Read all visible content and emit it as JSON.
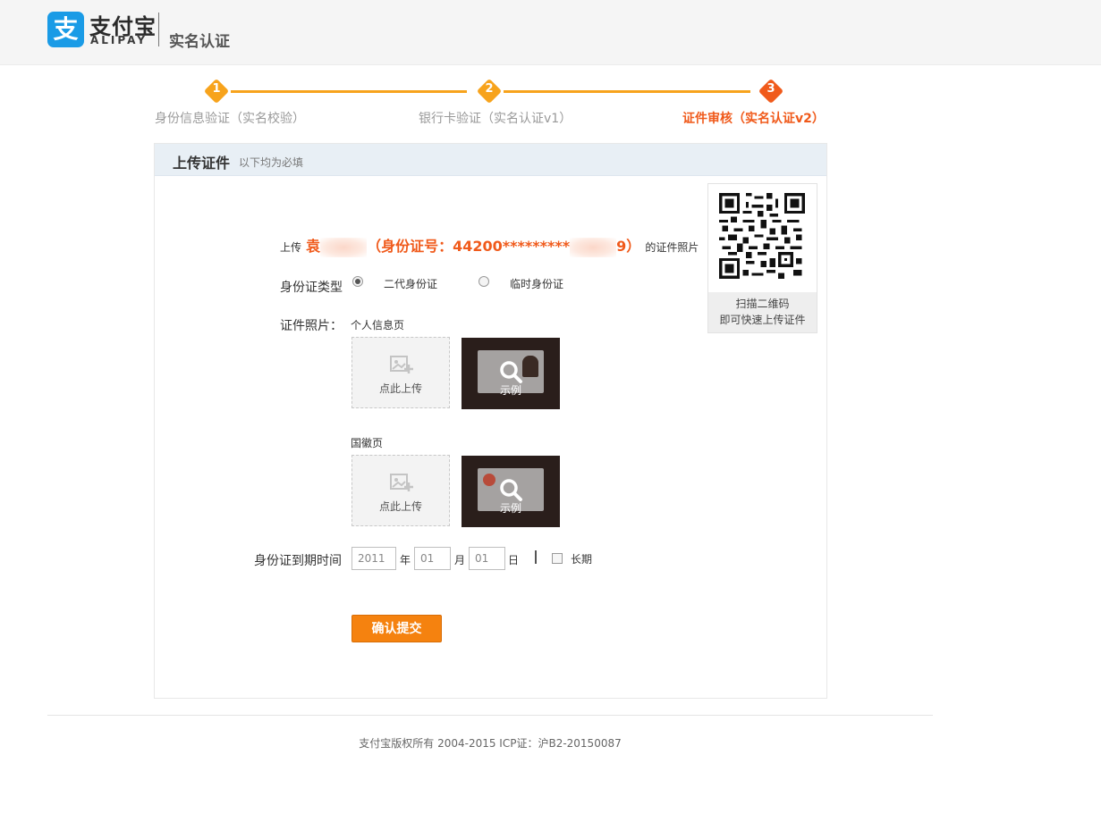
{
  "header": {
    "logo_glyph": "支",
    "logo_cn": "支付宝",
    "logo_en": "ALIPAY",
    "page_title": "实名认证"
  },
  "steps": [
    {
      "num": "1",
      "label": "身份信息验证（实名校验）",
      "active": false
    },
    {
      "num": "2",
      "label": "银行卡验证（实名认证v1）",
      "active": false
    },
    {
      "num": "3",
      "label": "证件审核（实名认证v2）",
      "active": true
    }
  ],
  "panel": {
    "title": "上传证件",
    "subtitle": "以下均为必填"
  },
  "upload_intro": {
    "prefix": "上传",
    "name_fragment": "袁",
    "id_label": "（身份证号：44200*********",
    "id_tail": "9）",
    "suffix": "的证件照片"
  },
  "qr": {
    "caption_line1": "扫描二维码",
    "caption_line2": "即可快速上传证件"
  },
  "id_type": {
    "label": "身份证类型",
    "options": [
      {
        "label": "二代身份证",
        "checked": true
      },
      {
        "label": "临时身份证",
        "checked": false
      }
    ]
  },
  "photos": {
    "label": "证件照片：",
    "front": {
      "title": "个人信息页",
      "upload_text": "点此上传",
      "sample_text": "示例"
    },
    "back": {
      "title": "国徽页",
      "upload_text": "点此上传",
      "sample_text": "示例"
    }
  },
  "expiry": {
    "label": "身份证到期时间",
    "year": "2011",
    "year_unit": "年",
    "month": "01",
    "month_unit": "月",
    "day": "01",
    "day_unit": "日",
    "long_term_label": "长期"
  },
  "submit_label": "确认提交",
  "footer": {
    "copyright": "支付宝版权所有 2004-2015 ICP证：沪B2-20150087"
  },
  "colors": {
    "accent_orange": "#f7a31c",
    "active_orange": "#f05a1b",
    "button_orange": "#f5820f",
    "alipay_blue": "#1a9be6"
  }
}
